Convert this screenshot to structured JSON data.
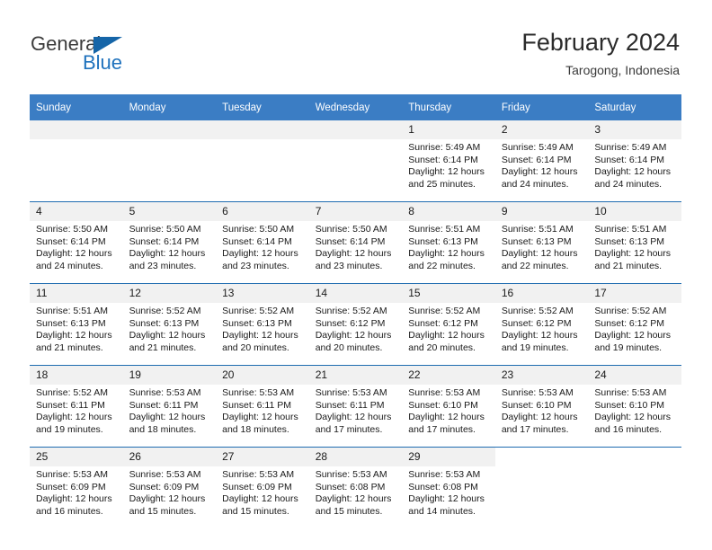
{
  "logo": {
    "word_top": "General",
    "word_bottom": "Blue",
    "triangle_icon": "triangle-icon",
    "color_dark": "#3c3c3c",
    "color_blue": "#1f72bd"
  },
  "header": {
    "title": "February 2024",
    "subtitle": "Tarogong, Indonesia"
  },
  "colors": {
    "header_bar": "#3b7dc4",
    "row_divider": "#1f6cb0",
    "daynum_band": "#f1f1f1",
    "text": "#1a1a1a"
  },
  "weekdays": [
    "Sunday",
    "Monday",
    "Tuesday",
    "Wednesday",
    "Thursday",
    "Friday",
    "Saturday"
  ],
  "weeks": [
    [
      {
        "day": "",
        "empty": true,
        "sunrise": "",
        "sunset": "",
        "daylight_line1": "",
        "daylight_line2": ""
      },
      {
        "day": "",
        "empty": true,
        "sunrise": "",
        "sunset": "",
        "daylight_line1": "",
        "daylight_line2": ""
      },
      {
        "day": "",
        "empty": true,
        "sunrise": "",
        "sunset": "",
        "daylight_line1": "",
        "daylight_line2": ""
      },
      {
        "day": "",
        "empty": true,
        "sunrise": "",
        "sunset": "",
        "daylight_line1": "",
        "daylight_line2": ""
      },
      {
        "day": "1",
        "sunrise": "Sunrise: 5:49 AM",
        "sunset": "Sunset: 6:14 PM",
        "daylight_line1": "Daylight: 12 hours",
        "daylight_line2": "and 25 minutes."
      },
      {
        "day": "2",
        "sunrise": "Sunrise: 5:49 AM",
        "sunset": "Sunset: 6:14 PM",
        "daylight_line1": "Daylight: 12 hours",
        "daylight_line2": "and 24 minutes."
      },
      {
        "day": "3",
        "sunrise": "Sunrise: 5:49 AM",
        "sunset": "Sunset: 6:14 PM",
        "daylight_line1": "Daylight: 12 hours",
        "daylight_line2": "and 24 minutes."
      }
    ],
    [
      {
        "day": "4",
        "sunrise": "Sunrise: 5:50 AM",
        "sunset": "Sunset: 6:14 PM",
        "daylight_line1": "Daylight: 12 hours",
        "daylight_line2": "and 24 minutes."
      },
      {
        "day": "5",
        "sunrise": "Sunrise: 5:50 AM",
        "sunset": "Sunset: 6:14 PM",
        "daylight_line1": "Daylight: 12 hours",
        "daylight_line2": "and 23 minutes."
      },
      {
        "day": "6",
        "sunrise": "Sunrise: 5:50 AM",
        "sunset": "Sunset: 6:14 PM",
        "daylight_line1": "Daylight: 12 hours",
        "daylight_line2": "and 23 minutes."
      },
      {
        "day": "7",
        "sunrise": "Sunrise: 5:50 AM",
        "sunset": "Sunset: 6:14 PM",
        "daylight_line1": "Daylight: 12 hours",
        "daylight_line2": "and 23 minutes."
      },
      {
        "day": "8",
        "sunrise": "Sunrise: 5:51 AM",
        "sunset": "Sunset: 6:13 PM",
        "daylight_line1": "Daylight: 12 hours",
        "daylight_line2": "and 22 minutes."
      },
      {
        "day": "9",
        "sunrise": "Sunrise: 5:51 AM",
        "sunset": "Sunset: 6:13 PM",
        "daylight_line1": "Daylight: 12 hours",
        "daylight_line2": "and 22 minutes."
      },
      {
        "day": "10",
        "sunrise": "Sunrise: 5:51 AM",
        "sunset": "Sunset: 6:13 PM",
        "daylight_line1": "Daylight: 12 hours",
        "daylight_line2": "and 21 minutes."
      }
    ],
    [
      {
        "day": "11",
        "sunrise": "Sunrise: 5:51 AM",
        "sunset": "Sunset: 6:13 PM",
        "daylight_line1": "Daylight: 12 hours",
        "daylight_line2": "and 21 minutes."
      },
      {
        "day": "12",
        "sunrise": "Sunrise: 5:52 AM",
        "sunset": "Sunset: 6:13 PM",
        "daylight_line1": "Daylight: 12 hours",
        "daylight_line2": "and 21 minutes."
      },
      {
        "day": "13",
        "sunrise": "Sunrise: 5:52 AM",
        "sunset": "Sunset: 6:13 PM",
        "daylight_line1": "Daylight: 12 hours",
        "daylight_line2": "and 20 minutes."
      },
      {
        "day": "14",
        "sunrise": "Sunrise: 5:52 AM",
        "sunset": "Sunset: 6:12 PM",
        "daylight_line1": "Daylight: 12 hours",
        "daylight_line2": "and 20 minutes."
      },
      {
        "day": "15",
        "sunrise": "Sunrise: 5:52 AM",
        "sunset": "Sunset: 6:12 PM",
        "daylight_line1": "Daylight: 12 hours",
        "daylight_line2": "and 20 minutes."
      },
      {
        "day": "16",
        "sunrise": "Sunrise: 5:52 AM",
        "sunset": "Sunset: 6:12 PM",
        "daylight_line1": "Daylight: 12 hours",
        "daylight_line2": "and 19 minutes."
      },
      {
        "day": "17",
        "sunrise": "Sunrise: 5:52 AM",
        "sunset": "Sunset: 6:12 PM",
        "daylight_line1": "Daylight: 12 hours",
        "daylight_line2": "and 19 minutes."
      }
    ],
    [
      {
        "day": "18",
        "sunrise": "Sunrise: 5:52 AM",
        "sunset": "Sunset: 6:11 PM",
        "daylight_line1": "Daylight: 12 hours",
        "daylight_line2": "and 19 minutes."
      },
      {
        "day": "19",
        "sunrise": "Sunrise: 5:53 AM",
        "sunset": "Sunset: 6:11 PM",
        "daylight_line1": "Daylight: 12 hours",
        "daylight_line2": "and 18 minutes."
      },
      {
        "day": "20",
        "sunrise": "Sunrise: 5:53 AM",
        "sunset": "Sunset: 6:11 PM",
        "daylight_line1": "Daylight: 12 hours",
        "daylight_line2": "and 18 minutes."
      },
      {
        "day": "21",
        "sunrise": "Sunrise: 5:53 AM",
        "sunset": "Sunset: 6:11 PM",
        "daylight_line1": "Daylight: 12 hours",
        "daylight_line2": "and 17 minutes."
      },
      {
        "day": "22",
        "sunrise": "Sunrise: 5:53 AM",
        "sunset": "Sunset: 6:10 PM",
        "daylight_line1": "Daylight: 12 hours",
        "daylight_line2": "and 17 minutes."
      },
      {
        "day": "23",
        "sunrise": "Sunrise: 5:53 AM",
        "sunset": "Sunset: 6:10 PM",
        "daylight_line1": "Daylight: 12 hours",
        "daylight_line2": "and 17 minutes."
      },
      {
        "day": "24",
        "sunrise": "Sunrise: 5:53 AM",
        "sunset": "Sunset: 6:10 PM",
        "daylight_line1": "Daylight: 12 hours",
        "daylight_line2": "and 16 minutes."
      }
    ],
    [
      {
        "day": "25",
        "sunrise": "Sunrise: 5:53 AM",
        "sunset": "Sunset: 6:09 PM",
        "daylight_line1": "Daylight: 12 hours",
        "daylight_line2": "and 16 minutes."
      },
      {
        "day": "26",
        "sunrise": "Sunrise: 5:53 AM",
        "sunset": "Sunset: 6:09 PM",
        "daylight_line1": "Daylight: 12 hours",
        "daylight_line2": "and 15 minutes."
      },
      {
        "day": "27",
        "sunrise": "Sunrise: 5:53 AM",
        "sunset": "Sunset: 6:09 PM",
        "daylight_line1": "Daylight: 12 hours",
        "daylight_line2": "and 15 minutes."
      },
      {
        "day": "28",
        "sunrise": "Sunrise: 5:53 AM",
        "sunset": "Sunset: 6:08 PM",
        "daylight_line1": "Daylight: 12 hours",
        "daylight_line2": "and 15 minutes."
      },
      {
        "day": "29",
        "sunrise": "Sunrise: 5:53 AM",
        "sunset": "Sunset: 6:08 PM",
        "daylight_line1": "Daylight: 12 hours",
        "daylight_line2": "and 14 minutes."
      },
      {
        "day": "",
        "blank": true,
        "sunrise": "",
        "sunset": "",
        "daylight_line1": "",
        "daylight_line2": ""
      },
      {
        "day": "",
        "blank": true,
        "sunrise": "",
        "sunset": "",
        "daylight_line1": "",
        "daylight_line2": ""
      }
    ]
  ]
}
